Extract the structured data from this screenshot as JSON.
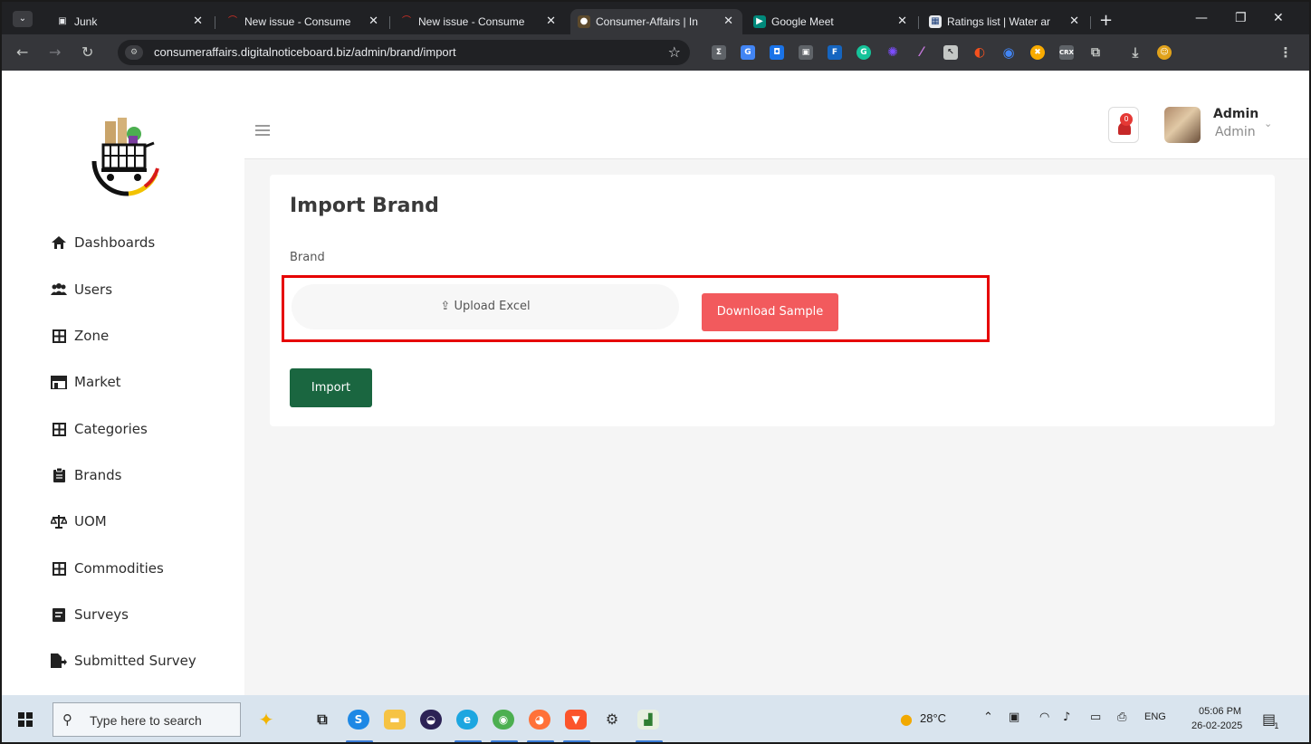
{
  "browser": {
    "tabs": [
      {
        "label": "Junk",
        "icon": "folder-icon"
      },
      {
        "label": "New issue - Consume",
        "icon": "issue-icon"
      },
      {
        "label": "New issue - Consume",
        "icon": "issue-icon"
      },
      {
        "label": "Consumer-Affairs | In",
        "icon": "site-icon",
        "active": true
      },
      {
        "label": "Google Meet",
        "icon": "meet-icon"
      },
      {
        "label": "Ratings list | Water ar",
        "icon": "ratings-icon"
      }
    ],
    "url": "consumeraffairs.digitalnoticeboard.biz/admin/brand/import"
  },
  "sidebar": {
    "items": [
      {
        "label": "Dashboards",
        "icon": "home-icon"
      },
      {
        "label": "Users",
        "icon": "users-icon"
      },
      {
        "label": "Zone",
        "icon": "grid-icon"
      },
      {
        "label": "Market",
        "icon": "store-icon"
      },
      {
        "label": "Categories",
        "icon": "grid-icon"
      },
      {
        "label": "Brands",
        "icon": "clipboard-icon"
      },
      {
        "label": "UOM",
        "icon": "scale-icon"
      },
      {
        "label": "Commodities",
        "icon": "grid-icon"
      },
      {
        "label": "Surveys",
        "icon": "form-icon"
      },
      {
        "label": "Submitted Survey",
        "icon": "file-export-icon"
      }
    ]
  },
  "header": {
    "notification_count": "0",
    "user_name": "Admin",
    "user_role": "Admin"
  },
  "main": {
    "title": "Import Brand",
    "field_label": "Brand",
    "upload_label": "Upload Excel",
    "download_label": "Download Sample",
    "import_label": "Import"
  },
  "taskbar": {
    "search_placeholder": "Type here to search",
    "temperature": "28°C",
    "language": "ENG",
    "time": "05:06 PM",
    "date": "26-02-2025",
    "notifications": "1"
  },
  "colors": {
    "import_button": "#1a6640",
    "download_button": "#f25a5d",
    "highlight_border": "#e60000"
  }
}
